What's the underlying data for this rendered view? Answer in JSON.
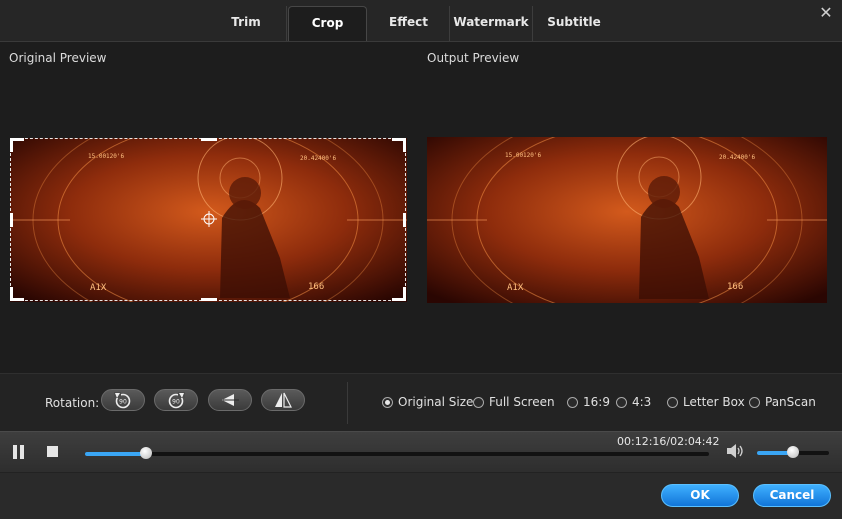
{
  "tabs": [
    {
      "label": "Trim",
      "active": false
    },
    {
      "label": "Crop",
      "active": true
    },
    {
      "label": "Effect",
      "active": false
    },
    {
      "label": "Watermark",
      "active": false
    },
    {
      "label": "Subtitle",
      "active": false
    }
  ],
  "preview": {
    "original_label": "Original Preview",
    "output_label": "Output Preview",
    "hud_texts": {
      "top_left": "15.00120'6",
      "top_right": "20.42400'6",
      "bottom_left": "A1X",
      "bottom_right": "166"
    }
  },
  "rotation": {
    "label": "Rotation:",
    "buttons": [
      "rotate-left-90",
      "rotate-right-90",
      "flip-horizontal",
      "flip-vertical"
    ],
    "badge": "90"
  },
  "aspect": {
    "options": [
      "Original Size",
      "Full Screen",
      "16:9",
      "4:3",
      "Letter Box",
      "PanScan"
    ],
    "selected": "Original Size"
  },
  "player": {
    "time": "00:12:16/02:04:42",
    "progress_fraction": 0.098,
    "volume_fraction": 0.5
  },
  "actions": {
    "ok_label": "OK",
    "cancel_label": "Cancel"
  },
  "colors": {
    "accent": "#3aa6f5",
    "video_glow": "#ff6a1a"
  }
}
